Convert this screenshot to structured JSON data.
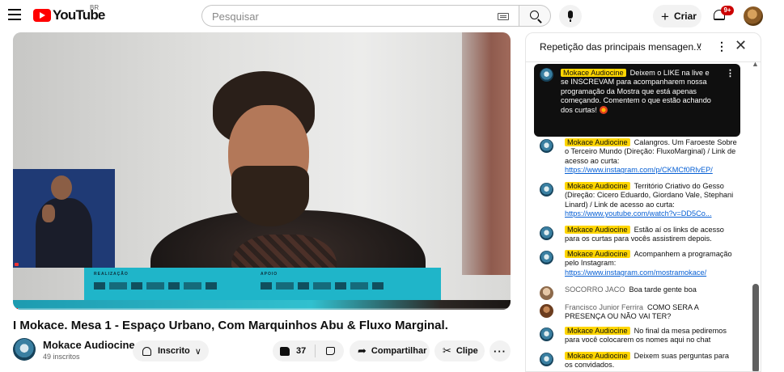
{
  "header": {
    "logo_text": "YouTube",
    "region": "BR",
    "search_placeholder": "Pesquisar",
    "create_label": "Criar",
    "notifications_count": "9+"
  },
  "video": {
    "title": "I Mokace. Mesa 1 - Espaço Urbano, Com Marquinhos Abu & Fluxo Marginal.",
    "banner_realizacao": "REALIZAÇÃO",
    "banner_apoio": "APOIO",
    "progress": 0.01
  },
  "channel": {
    "name": "Mokace Audiocine",
    "subscribers": "49 inscritos",
    "subscribe_label": "Inscrito"
  },
  "actions": {
    "like_count": "37",
    "share_label": "Compartilhar",
    "clip_label": "Clipe"
  },
  "chat": {
    "mode_label": "Repetição das principais mensagen...",
    "pinned": {
      "author": "Mokace Audiocine",
      "text": "Deixem o LIKE na live e se INSCREVAM para acompanharem nossa programação da Mostra que está apenas começando. Comentem o que estão achando dos curtas!"
    },
    "messages": [
      {
        "author": "Mokace Audiocine",
        "owner": true,
        "text": "Calangros. Um Faroeste Sobre o Terceiro Mundo (Direção: FluxoMarginal) / Link de acesso ao curta: ",
        "link": "https://www.instagram.com/p/CKMCf0RlvEP/"
      },
      {
        "author": "Mokace Audiocine",
        "owner": true,
        "text": "Território Criativo do Gesso (Direção: Cicero Eduardo, Giordano Vale, Stephani Linard) / Link de acesso ao curta: ",
        "link": "https://www.youtube.com/watch?v=DD5Co..."
      },
      {
        "author": "Mokace Audiocine",
        "owner": true,
        "text": "Estão aí os links de acesso para os curtas para vocês assistirem depois.",
        "link": ""
      },
      {
        "author": "Mokace Audiocine",
        "owner": true,
        "text": "Acompanhem a programação pelo Instagram: ",
        "link": "https://www.instagram.com/mostramokace/"
      },
      {
        "author": "SOCORRO JACO",
        "owner": false,
        "text": "Boa tarde gente boa",
        "link": ""
      },
      {
        "author": "Francisco Junior Ferrira",
        "owner": false,
        "text": "COMO SERA A PRESENÇA OU NÃO VAI TER?",
        "link": ""
      },
      {
        "author": "Mokace Audiocine",
        "owner": true,
        "text": "No final da mesa pediremos para você colocarem os nomes aqui no chat",
        "link": ""
      },
      {
        "author": "Mokace Audiocine",
        "owner": true,
        "text": "Deixem suas perguntas para os convidados.",
        "link": ""
      }
    ]
  },
  "colors": {
    "brand_red": "#ff0000",
    "owner_badge": "#ffd600",
    "link_blue": "#065fd4",
    "banner_cyan": "#1fb5c9"
  }
}
